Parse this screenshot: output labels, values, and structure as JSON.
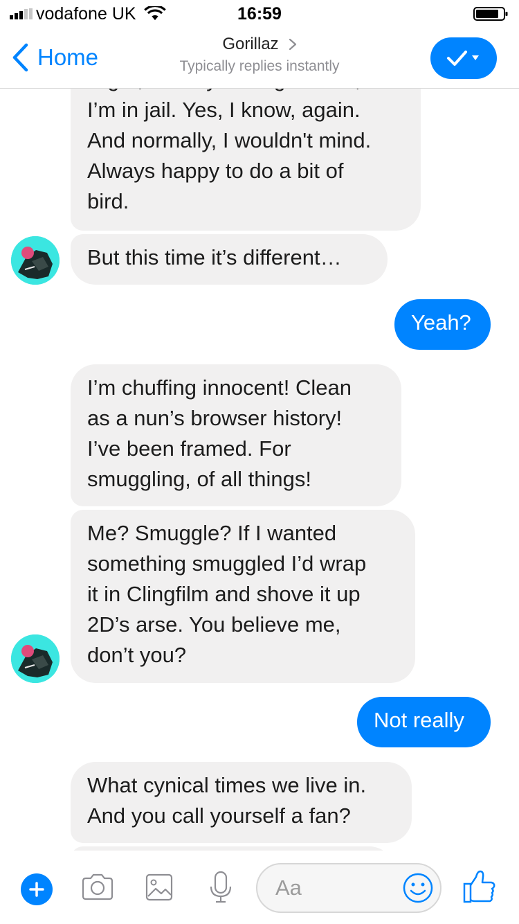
{
  "status_bar": {
    "carrier": "vodafone UK",
    "time": "16:59"
  },
  "header": {
    "back_label": "Home",
    "title": "Gorillaz",
    "subtitle": "Typically replies instantly"
  },
  "messages": [
    {
      "from": "them",
      "text": "Right, so as you've guessed,\nI’m in jail. Yes, I know, again.\nAnd normally, I wouldn't mind.\nAlways happy to do a bit of\nbird."
    },
    {
      "from": "them",
      "text": "But this time it’s different…"
    },
    {
      "from": "me",
      "text": "Yeah?"
    },
    {
      "from": "them",
      "text": "I’m chuffing innocent! Clean\nas a nun’s browser history!\nI’ve been framed. For\nsmuggling, of all things!"
    },
    {
      "from": "them",
      "text": "Me? Smuggle? If I wanted\nsomething smuggled I’d wrap\nit in Clingfilm and shove it up\n2D’s arse. You believe me,\ndon’t you?"
    },
    {
      "from": "me",
      "text": "Not really"
    },
    {
      "from": "them",
      "text": "What cynical times we live in.\nAnd you call yourself a fan?"
    }
  ],
  "composer": {
    "placeholder": "Aa"
  },
  "icons": {
    "add": "plus-icon",
    "camera": "camera-icon",
    "gallery": "image-icon",
    "voice": "microphone-icon",
    "emoji": "smiley-icon",
    "like": "thumbs-up-icon"
  },
  "colors": {
    "accent": "#0084ff",
    "incoming_bubble": "#f1f0f0",
    "avatar_background": "#3be6e1"
  }
}
